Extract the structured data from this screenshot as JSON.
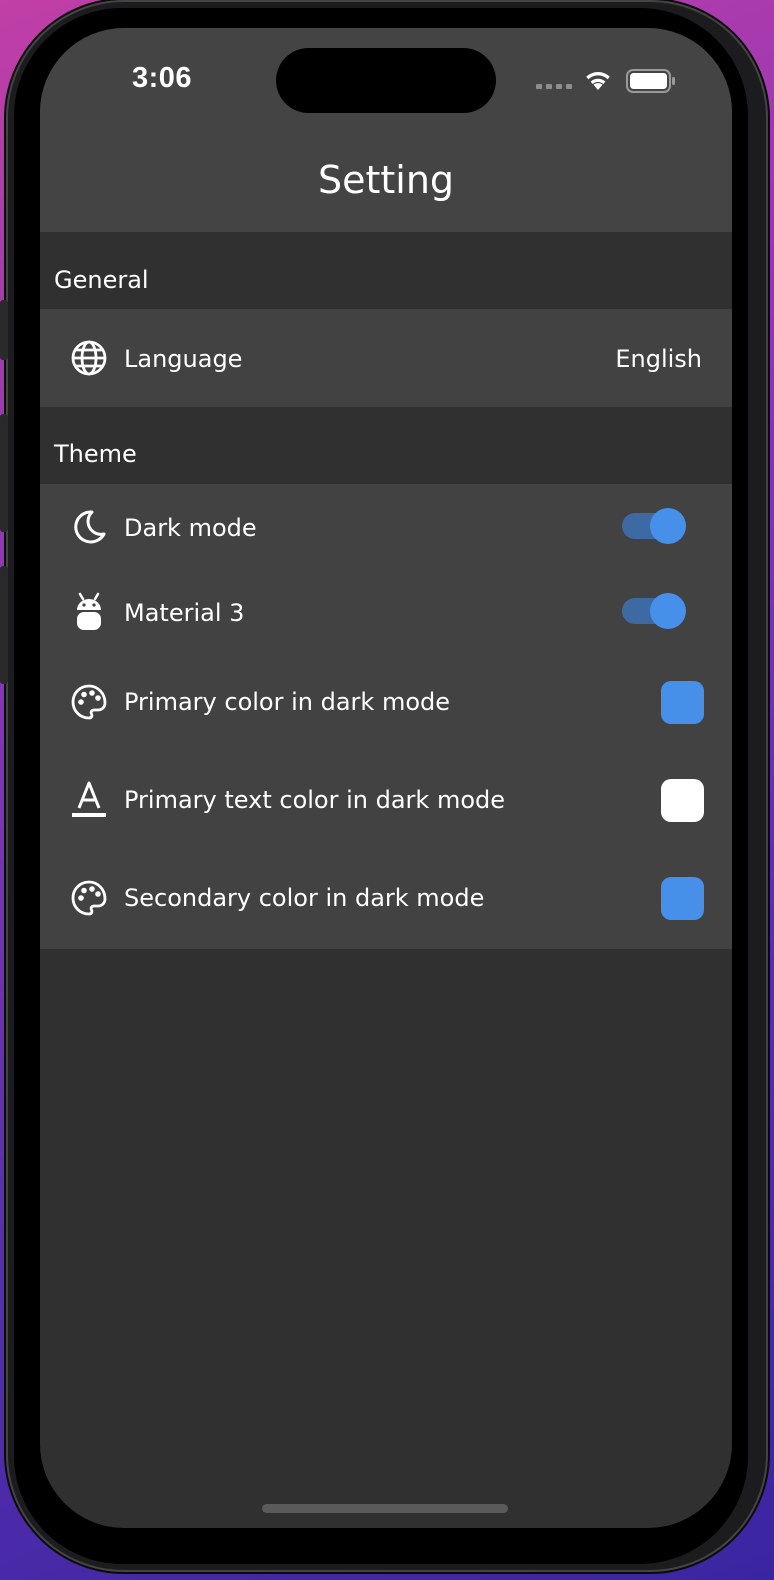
{
  "status_bar": {
    "time": "3:06"
  },
  "app_bar": {
    "title": "Setting"
  },
  "sections": {
    "general": {
      "header": "General",
      "language": {
        "label": "Language",
        "value": "English",
        "icon": "globe-icon"
      }
    },
    "theme": {
      "header": "Theme",
      "dark_mode": {
        "label": "Dark mode",
        "icon": "moon-icon",
        "enabled": true
      },
      "material3": {
        "label": "Material 3",
        "icon": "android-icon",
        "enabled": true
      },
      "primary_color": {
        "label": "Primary color in dark mode",
        "icon": "palette-icon",
        "color": "#4690ea"
      },
      "primary_text_color": {
        "label": "Primary text color in dark mode",
        "icon": "text-format-icon",
        "color": "#ffffff"
      },
      "secondary_color": {
        "label": "Secondary color in dark mode",
        "icon": "palette-icon",
        "color": "#4690ea"
      }
    }
  },
  "colors": {
    "accent": "#4690ea",
    "toggle_track": "#3e6aa3",
    "app_bar": "#444444",
    "section_bg": "#303030",
    "group_bg": "#424242"
  }
}
